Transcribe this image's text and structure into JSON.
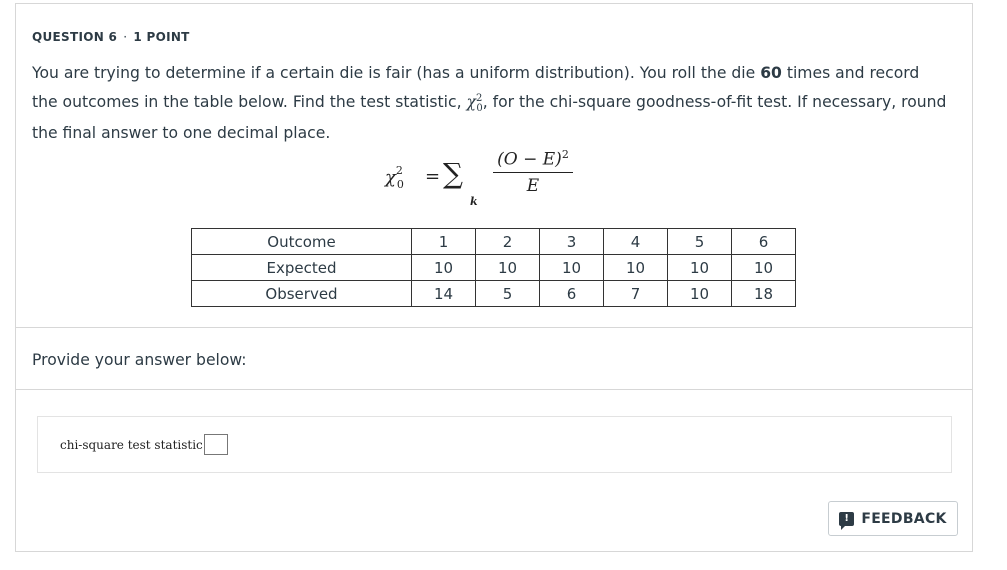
{
  "question": {
    "number_label": "QUESTION 6",
    "separator": "·",
    "points_label": "1 POINT",
    "text_part1": "You are trying to determine if a certain die is fair (has a uniform distribution). You roll the die ",
    "rolls": "60",
    "text_part2": " times and record the outcomes in the table below. Find the test statistic, ",
    "text_part3": ", for the chi-square goodness-of-fit test. If necessary, round the final answer to one decimal place."
  },
  "formula": {
    "lhs_symbol": "χ",
    "lhs_sup": "2",
    "lhs_sub": "0",
    "equals": "=",
    "sum_symbol": "∑",
    "sum_index": "k",
    "numerator": "(O − E)",
    "numerator_sup": "2",
    "denominator": "E"
  },
  "table": {
    "rows": [
      {
        "label": "Outcome",
        "values": [
          "1",
          "2",
          "3",
          "4",
          "5",
          "6"
        ]
      },
      {
        "label": "Expected",
        "values": [
          "10",
          "10",
          "10",
          "10",
          "10",
          "10"
        ]
      },
      {
        "label": "Observed",
        "values": [
          "14",
          "5",
          "6",
          "7",
          "10",
          "18"
        ]
      }
    ]
  },
  "answer_section": {
    "prompt": "Provide your answer below:",
    "field_label": "chi-square test statistic=",
    "field_value": ""
  },
  "feedback_button": {
    "icon": "feedback-icon",
    "label": "FEEDBACK"
  }
}
